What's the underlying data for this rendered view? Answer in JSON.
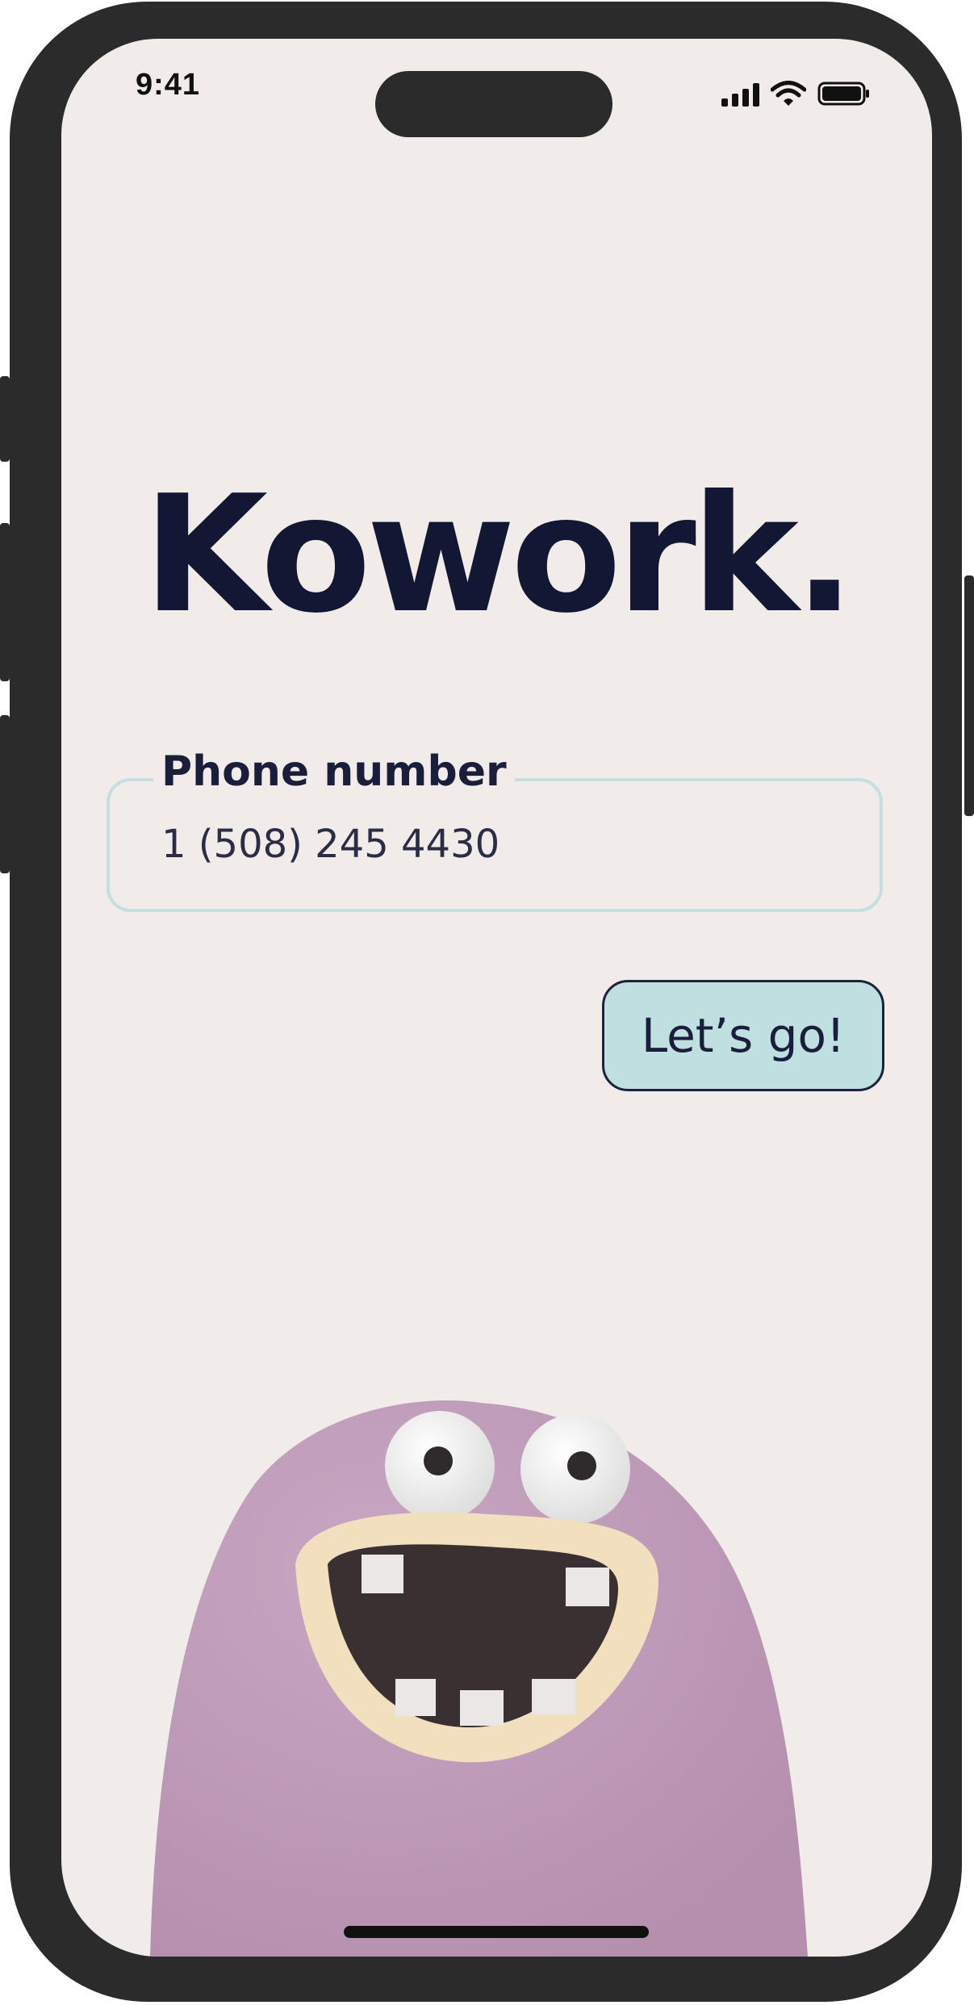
{
  "status_bar": {
    "time": "9:41",
    "icons": [
      "signal-icon",
      "wifi-icon",
      "battery-icon"
    ]
  },
  "app": {
    "title": "Kowork."
  },
  "phone_field": {
    "label": "Phone number",
    "value": "1 (508) 245 4430"
  },
  "actions": {
    "go_label": "Let’s go!"
  },
  "colors": {
    "background": "#f1ece9",
    "title": "#121733",
    "field_border": "#c3dfe0",
    "button_fill": "#bfdfe0",
    "mascot_body": "#c19fbb"
  }
}
